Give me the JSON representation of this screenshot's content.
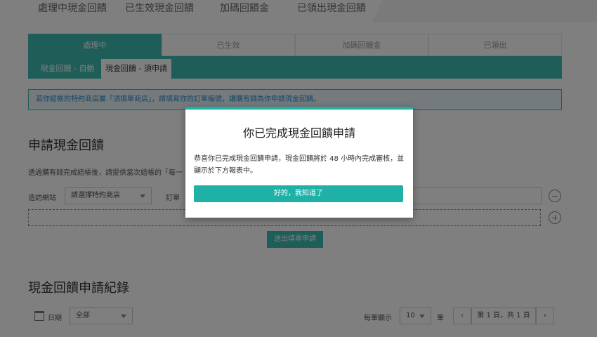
{
  "topnav": {
    "items": [
      "處理中現金回饋",
      "已生效現金回饋",
      "加碼回饋金",
      "已領出現金回饋"
    ]
  },
  "tabs": {
    "items": [
      "處理中",
      "已生效",
      "加碼回饋金",
      "已領出"
    ]
  },
  "subtabs": {
    "auto": "現金回饋 - 自動",
    "apply": "現金回饋 - 須申請"
  },
  "notice": "若你結帳的特約商店屬「須填單商店」，請填寫你的訂單編號，讓購有錢為你申請現金回饋。",
  "apply_section": {
    "title": "申請現金回饋",
    "desc": "透過購有錢完成結帳後，請提供當次結帳的「每一",
    "site_label": "造訪網站",
    "site_select": "請選擇特約商店",
    "order_label": "訂單",
    "submit": "送出填單申請"
  },
  "records": {
    "title": "現金回饋申請紀錄",
    "date_label": "日期",
    "date_select": "全部",
    "per_page_label": "每筆顯示",
    "per_page_value": "10",
    "per_page_unit": "筆",
    "page_info": "第 1 頁，共 1 頁"
  },
  "modal": {
    "title": "你已完成現金回饋申請",
    "body": "恭喜你已完成現金回饋申請，現金回饋將於 48 小時內完成審核，並顯示於下方報表中。",
    "ok": "好的，我知道了"
  },
  "colors": {
    "accent": "#3dbab0",
    "notice_border": "#3dbab0",
    "modal_button": "#1fb0a6"
  }
}
